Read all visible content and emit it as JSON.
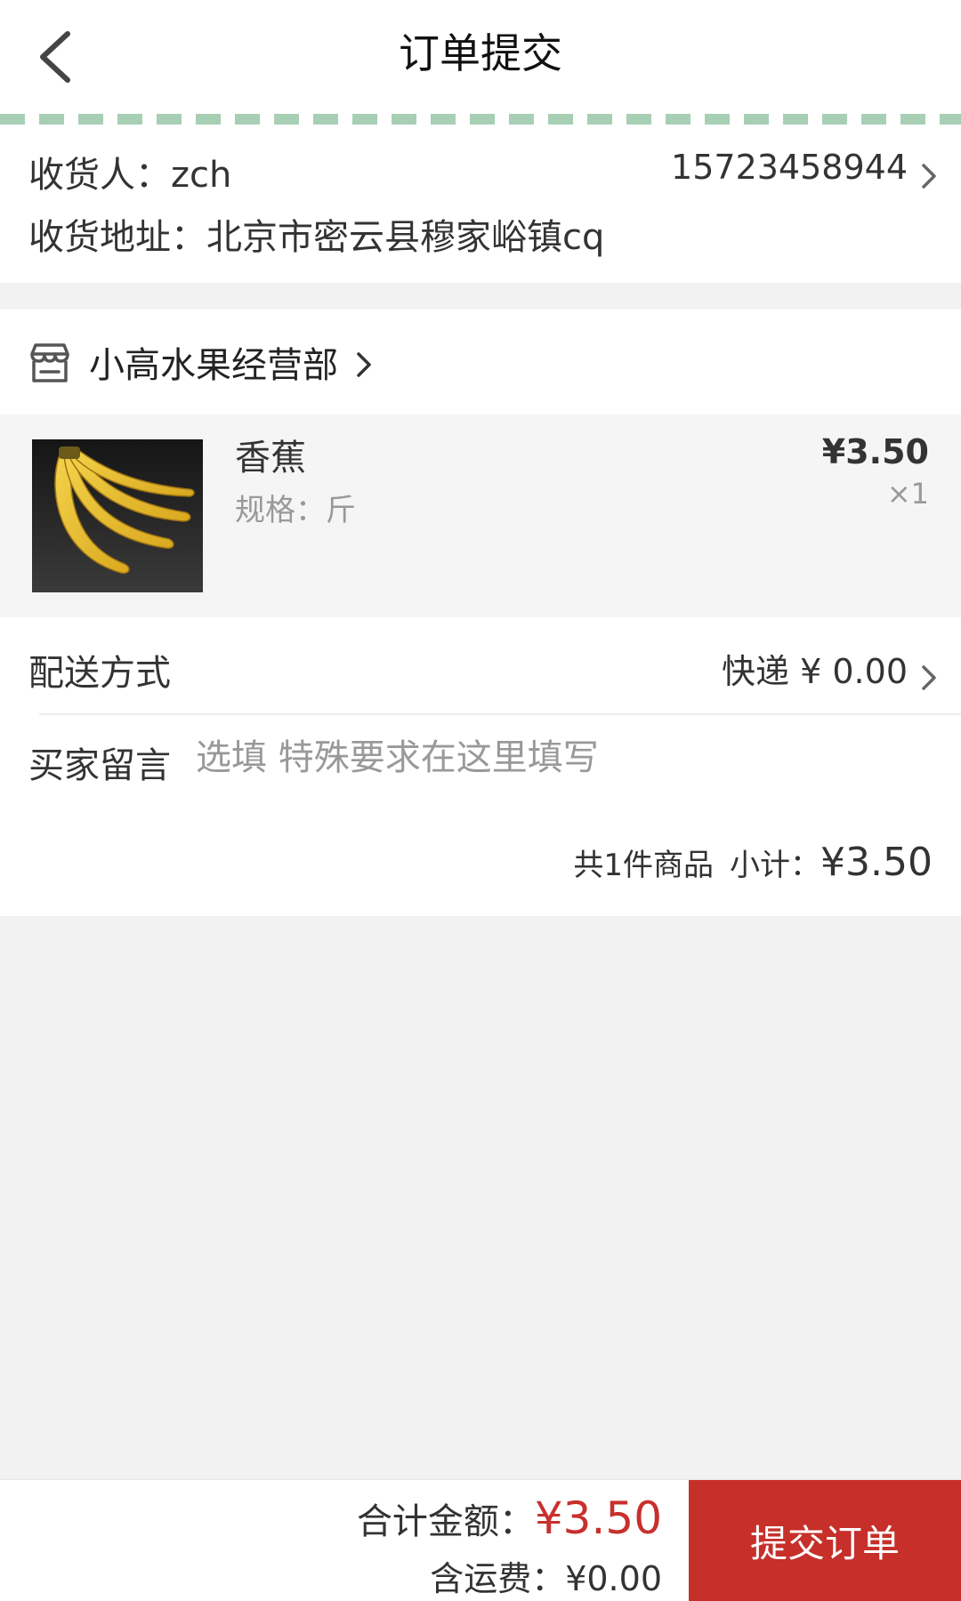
{
  "header": {
    "title": "订单提交",
    "back_icon": "chevron-left-icon"
  },
  "address": {
    "consignee_label": "收货人：",
    "consignee_name": "zch",
    "phone": "15723458944",
    "address_label": "收货地址：",
    "address_text": "北京市密云县穆家峪镇cq"
  },
  "store": {
    "name": "小高水果经营部",
    "icon": "store-icon"
  },
  "product": {
    "name": "香蕉",
    "spec_label": "规格：",
    "spec_value": "斤",
    "price": "¥3.50",
    "quantity": "×1",
    "image": "banana-image"
  },
  "delivery": {
    "label": "配送方式",
    "method": "快递",
    "fee": "¥ 0.00"
  },
  "message": {
    "label": "买家留言",
    "placeholder": "选填 特殊要求在这里填写",
    "value": ""
  },
  "subtotal": {
    "count_text": "共1件商品",
    "label": "小计：",
    "amount": "¥3.50"
  },
  "footer": {
    "total_label": "合计金额：",
    "total_amount": "¥3.50",
    "shipping_label": "含运费：",
    "shipping_amount": "¥0.00",
    "submit_label": "提交订单"
  },
  "colors": {
    "accent_red": "#c62f2a",
    "price_red": "#c8302d",
    "dash_green": "#a7cfb4",
    "background": "#f2f2f2"
  }
}
